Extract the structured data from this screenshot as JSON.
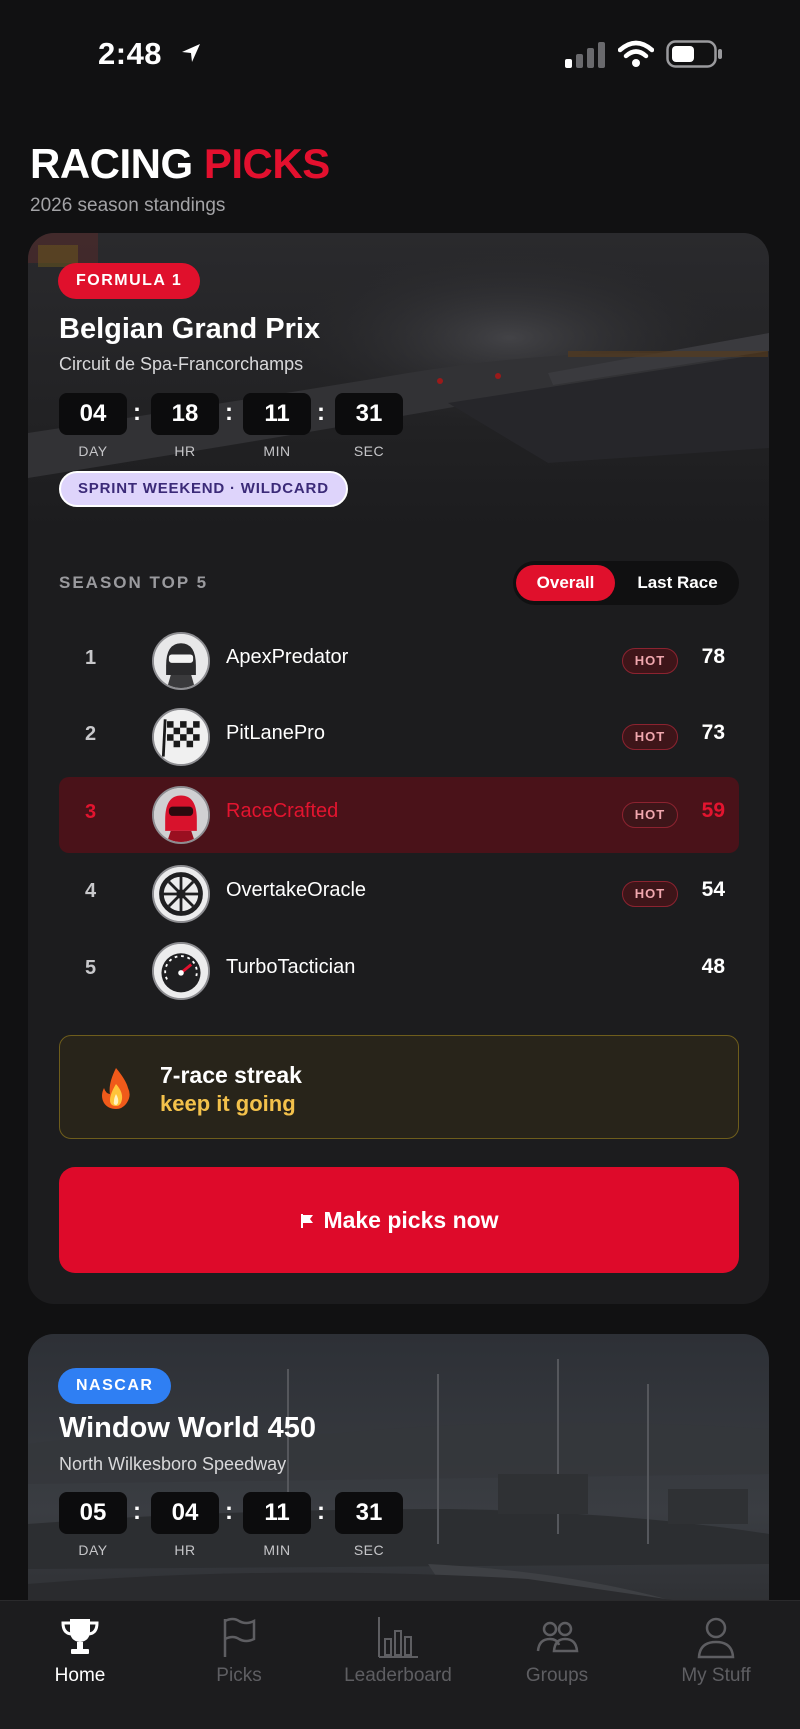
{
  "status_bar": {
    "time": "2:48"
  },
  "header": {
    "title_part1": "RACING",
    "title_part2": "PICKS",
    "subtitle": "2026 season standings"
  },
  "featured_race": {
    "series": "FORMULA 1",
    "series_color": "#e0102c",
    "name": "Belgian Grand Prix",
    "venue": "Circuit de Spa-Francorchamps",
    "countdown": [
      {
        "value": "04",
        "label": "DAY"
      },
      {
        "value": "18",
        "label": "HR"
      },
      {
        "value": "11",
        "label": "MIN"
      },
      {
        "value": "31",
        "label": "SEC"
      }
    ],
    "tag": "SPRINT WEEKEND · WILDCARD"
  },
  "standings": {
    "label": "SEASON TOP 5",
    "filters": [
      "Overall",
      "Last Race"
    ],
    "active_filter": "Overall",
    "rows": [
      {
        "rank": "1",
        "name": "ApexPredator",
        "hot": "HOT",
        "points": "78",
        "avatar": "helmet-icon"
      },
      {
        "rank": "2",
        "name": "PitLanePro",
        "hot": "HOT",
        "points": "73",
        "avatar": "checkered-flag-icon"
      },
      {
        "rank": "3",
        "name": "RaceCrafted",
        "hot": "HOT",
        "points": "59",
        "avatar": "red-helmet-icon",
        "is_current_user": true
      },
      {
        "rank": "4",
        "name": "OvertakeOracle",
        "hot": "HOT",
        "points": "54",
        "avatar": "wheel-icon"
      },
      {
        "rank": "5",
        "name": "TurboTactician",
        "hot": "",
        "points": "48",
        "avatar": "speedometer-icon"
      }
    ]
  },
  "streak": {
    "title": "7-race streak",
    "subtitle": "keep it going",
    "icon": "fire-icon"
  },
  "cta": {
    "label": "Make picks now",
    "icon": "flag-icon"
  },
  "next_race": {
    "series": "NASCAR",
    "series_color": "#2f7ff3",
    "name": "Window World 450",
    "venue": "North Wilkesboro Speedway",
    "countdown": [
      {
        "value": "05",
        "label": "DAY"
      },
      {
        "value": "04",
        "label": "HR"
      },
      {
        "value": "11",
        "label": "MIN"
      },
      {
        "value": "31",
        "label": "SEC"
      }
    ]
  },
  "tab_bar": [
    {
      "label": "Home",
      "icon": "trophy-icon",
      "active": true
    },
    {
      "label": "Picks",
      "icon": "flag-icon",
      "active": false
    },
    {
      "label": "Leaderboard",
      "icon": "bar-chart-icon",
      "active": false
    },
    {
      "label": "Groups",
      "icon": "group-icon",
      "active": false
    },
    {
      "label": "My Stuff",
      "icon": "person-icon",
      "active": false
    }
  ]
}
